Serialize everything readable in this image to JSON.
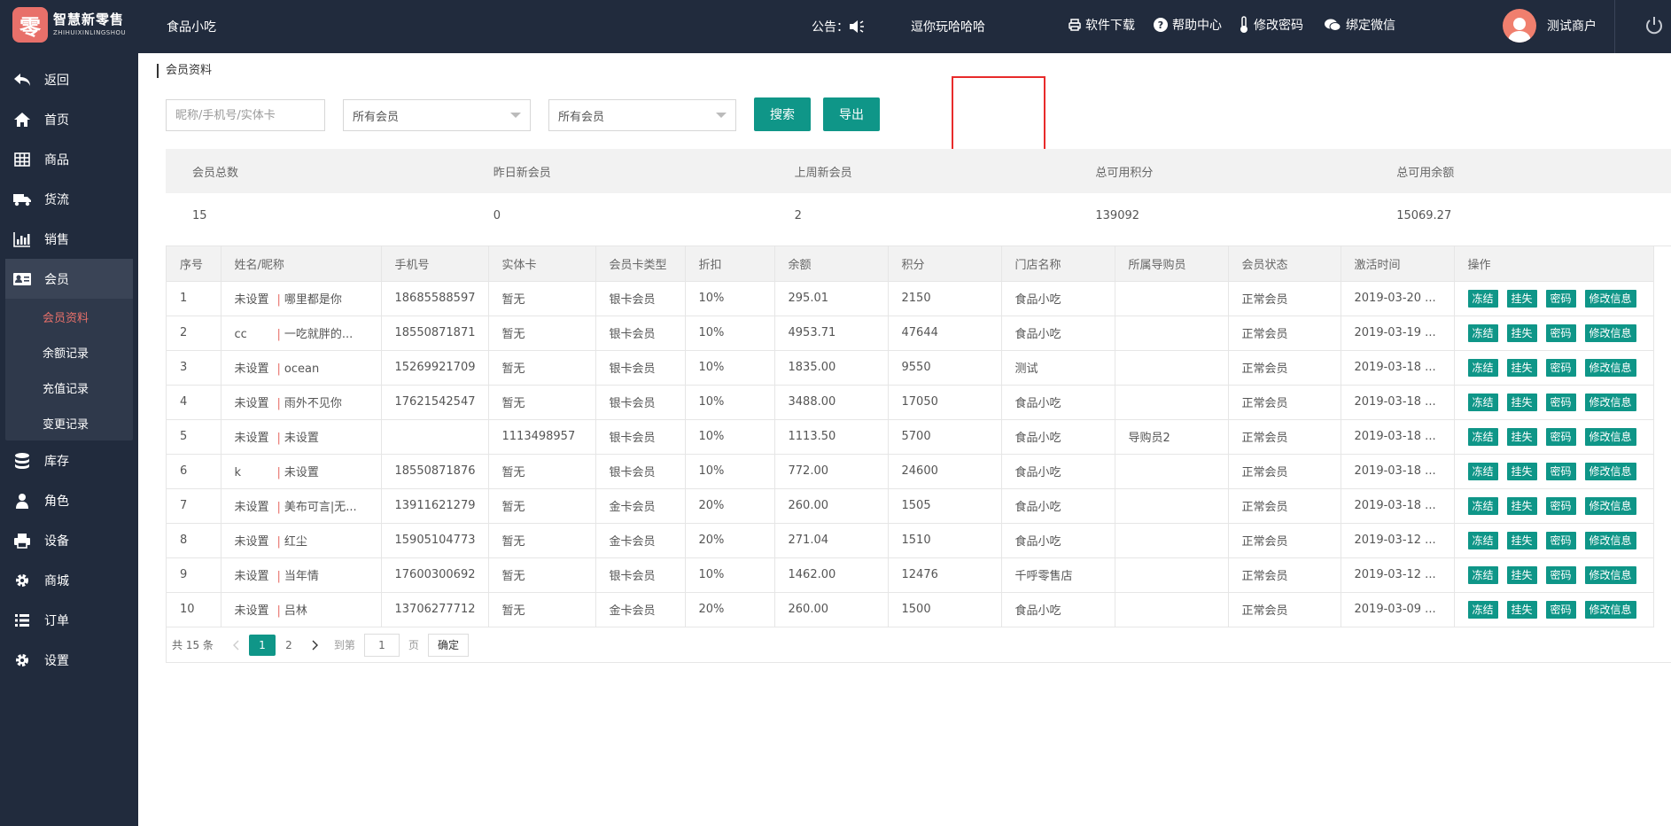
{
  "header": {
    "logo_cn": "智慧新零售",
    "logo_en": "ZHIHUIXINLINGSHOU",
    "logo_char": "零",
    "shop_name": "食品小吃",
    "notice_label": "公告：",
    "notice_text": "逗你玩哈哈哈",
    "links": [
      {
        "label": "软件下载",
        "icon": "printer-icon"
      },
      {
        "label": "帮助中心",
        "icon": "question-icon"
      },
      {
        "label": "修改密码",
        "icon": "thermometer-icon"
      },
      {
        "label": "绑定微信",
        "icon": "wechat-icon"
      }
    ],
    "user_name": "测试商户"
  },
  "sidebar": {
    "items": [
      {
        "label": "返回",
        "icon": "back-icon"
      },
      {
        "label": "首页",
        "icon": "home-icon"
      },
      {
        "label": "商品",
        "icon": "grid-icon"
      },
      {
        "label": "货流",
        "icon": "truck-icon"
      },
      {
        "label": "销售",
        "icon": "bar-chart-icon"
      },
      {
        "label": "会员",
        "icon": "id-card-icon"
      },
      {
        "label": "库存",
        "icon": "database-icon"
      },
      {
        "label": "角色",
        "icon": "user-icon"
      },
      {
        "label": "设备",
        "icon": "printer-icon"
      },
      {
        "label": "商城",
        "icon": "gear-icon"
      },
      {
        "label": "订单",
        "icon": "list-icon"
      },
      {
        "label": "设置",
        "icon": "gear-icon"
      }
    ],
    "sub_items": [
      "会员资料",
      "余额记录",
      "充值记录",
      "变更记录"
    ]
  },
  "breadcrumb": "会员资料",
  "filters": {
    "search_placeholder": "昵称/手机号/实体卡",
    "select1": "所有会员",
    "select2": "所有会员",
    "search_button": "搜索",
    "export_button": "导出"
  },
  "stats": {
    "headers": [
      "会员总数",
      "昨日新会员",
      "上周新会员",
      "总可用积分",
      "总可用余额"
    ],
    "values": [
      "15",
      "0",
      "2",
      "139092",
      "15069.27"
    ]
  },
  "table": {
    "columns": [
      "序号",
      "姓名/昵称",
      "手机号",
      "实体卡",
      "会员卡类型",
      "折扣",
      "余额",
      "积分",
      "门店名称",
      "所属导购员",
      "会员状态",
      "激活时间",
      "操作"
    ],
    "rows": [
      {
        "no": "1",
        "name": "未设置",
        "nick": "哪里都是你",
        "phone": "18685588597",
        "card": "暂无",
        "type": "银卡会员",
        "discount": "10%",
        "balance": "295.01",
        "points": "2150",
        "store": "食品小吃",
        "guide": "",
        "status": "正常会员",
        "time": "2019-03-20 ..."
      },
      {
        "no": "2",
        "name": "cc",
        "nick": "一吃就胖的...",
        "phone": "18550871871",
        "card": "暂无",
        "type": "银卡会员",
        "discount": "10%",
        "balance": "4953.71",
        "points": "47644",
        "store": "食品小吃",
        "guide": "",
        "status": "正常会员",
        "time": "2019-03-19 ..."
      },
      {
        "no": "3",
        "name": "未设置",
        "nick": "ocean",
        "phone": "15269921709",
        "card": "暂无",
        "type": "银卡会员",
        "discount": "10%",
        "balance": "1835.00",
        "points": "9550",
        "store": "测试",
        "guide": "",
        "status": "正常会员",
        "time": "2019-03-18 ..."
      },
      {
        "no": "4",
        "name": "未设置",
        "nick": "雨外不见你",
        "phone": "17621542547",
        "card": "暂无",
        "type": "银卡会员",
        "discount": "10%",
        "balance": "3488.00",
        "points": "17050",
        "store": "食品小吃",
        "guide": "",
        "status": "正常会员",
        "time": "2019-03-18 ..."
      },
      {
        "no": "5",
        "name": "未设置",
        "nick": "未设置",
        "phone": "",
        "card": "1113498957",
        "type": "银卡会员",
        "discount": "10%",
        "balance": "1113.50",
        "points": "5700",
        "store": "食品小吃",
        "guide": "导购员2",
        "status": "正常会员",
        "time": "2019-03-18 ..."
      },
      {
        "no": "6",
        "name": "k",
        "nick": "未设置",
        "phone": "18550871876",
        "card": "暂无",
        "type": "银卡会员",
        "discount": "10%",
        "balance": "772.00",
        "points": "24600",
        "store": "食品小吃",
        "guide": "",
        "status": "正常会员",
        "time": "2019-03-18 ..."
      },
      {
        "no": "7",
        "name": "未设置",
        "nick": "美布可言|无...",
        "phone": "13911621279",
        "card": "暂无",
        "type": "金卡会员",
        "discount": "20%",
        "balance": "260.00",
        "points": "1505",
        "store": "食品小吃",
        "guide": "",
        "status": "正常会员",
        "time": "2019-03-18 ..."
      },
      {
        "no": "8",
        "name": "未设置",
        "nick": "红尘",
        "phone": "15905104773",
        "card": "暂无",
        "type": "金卡会员",
        "discount": "20%",
        "balance": "271.04",
        "points": "1510",
        "store": "食品小吃",
        "guide": "",
        "status": "正常会员",
        "time": "2019-03-12 ..."
      },
      {
        "no": "9",
        "name": "未设置",
        "nick": "当年情",
        "phone": "17600300692",
        "card": "暂无",
        "type": "银卡会员",
        "discount": "10%",
        "balance": "1462.00",
        "points": "12476",
        "store": "千呼零售店",
        "guide": "",
        "status": "正常会员",
        "time": "2019-03-12 ..."
      },
      {
        "no": "10",
        "name": "未设置",
        "nick": "吕林",
        "phone": "13706277712",
        "card": "暂无",
        "type": "金卡会员",
        "discount": "20%",
        "balance": "260.00",
        "points": "1500",
        "store": "食品小吃",
        "guide": "",
        "status": "正常会员",
        "time": "2019-03-09 ..."
      }
    ],
    "actions": [
      "冻结",
      "挂失",
      "密码",
      "修改信息"
    ]
  },
  "pager": {
    "total": "共 15 条",
    "pages": [
      "1",
      "2"
    ],
    "current": "1",
    "goto_label": "到第",
    "goto_value": "1",
    "page_unit": "页",
    "confirm": "确定"
  },
  "colors": {
    "topbar": "#212b3d",
    "accent": "#0f9688",
    "active_sub": "#e8706a",
    "highlight_box": "#e82b2b"
  }
}
